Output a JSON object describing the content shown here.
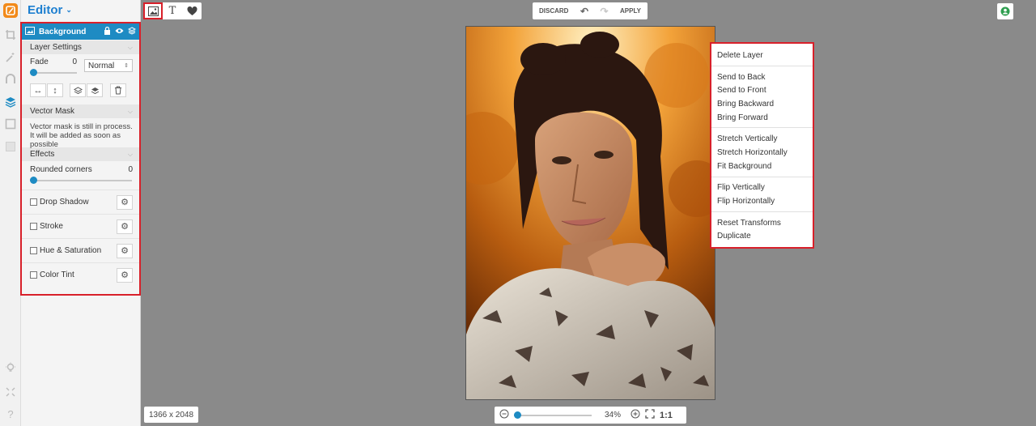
{
  "colors": {
    "accent": "#1e8bc3",
    "highlight": "#d8202a",
    "title": "#1d7fd0",
    "logo": "#f28a1a"
  },
  "editor": {
    "title": "Editor"
  },
  "rail": {
    "icons": [
      "crop-icon",
      "magic-wand-icon",
      "shape-icon",
      "layers-icon",
      "frame-icon",
      "texture-icon",
      "lightbulb-icon",
      "fullscreen-icon",
      "help-icon"
    ]
  },
  "layer": {
    "name": "Background",
    "settings_title": "Layer Settings",
    "fade_label": "Fade",
    "fade_value": "0",
    "fade_fraction": 0,
    "blend_mode": "Normal",
    "vector_mask_title": "Vector Mask",
    "vector_mask_text": "Vector mask is still in process. It will be added as soon as possible",
    "effects_title": "Effects",
    "rounded_label": "Rounded corners",
    "rounded_value": "0",
    "rounded_fraction": 0,
    "effects": [
      {
        "label": "Drop Shadow",
        "checked": false
      },
      {
        "label": "Stroke",
        "checked": false
      },
      {
        "label": "Hue & Saturation",
        "checked": false
      },
      {
        "label": "Color Tint",
        "checked": false
      }
    ]
  },
  "toolbar": {
    "discard": "DISCARD",
    "apply": "APPLY"
  },
  "context_menu": {
    "groups": [
      [
        "Delete Layer"
      ],
      [
        "Send to Back",
        "Send to Front",
        "Bring Backward",
        "Bring Forward"
      ],
      [
        "Stretch Vertically",
        "Stretch Horizontally",
        "Fit Background"
      ],
      [
        "Flip Vertically",
        "Flip Horizontally"
      ],
      [
        "Reset Transforms",
        "Duplicate"
      ]
    ]
  },
  "status": {
    "dimensions": "1366 x 2048",
    "zoom": "34%",
    "zoom_fraction": 0.0,
    "one_to_one": "1:1"
  }
}
